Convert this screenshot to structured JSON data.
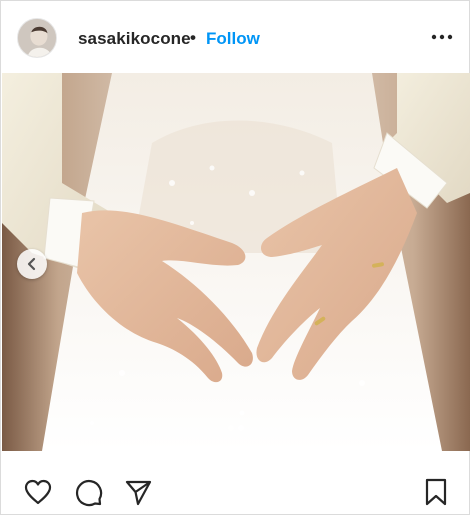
{
  "post": {
    "username": "sasakikocone",
    "separator": "•",
    "follow_label": "Follow"
  },
  "icons": {
    "more": "more-options-icon",
    "prev": "chevron-left-icon",
    "like": "heart-icon",
    "comment": "comment-icon",
    "share": "paper-plane-icon",
    "save": "bookmark-icon"
  },
  "carousel": {
    "total": 2,
    "active": 1
  },
  "colors": {
    "follow": "#0095f6",
    "text": "#262626",
    "border": "#dbdbdb"
  }
}
